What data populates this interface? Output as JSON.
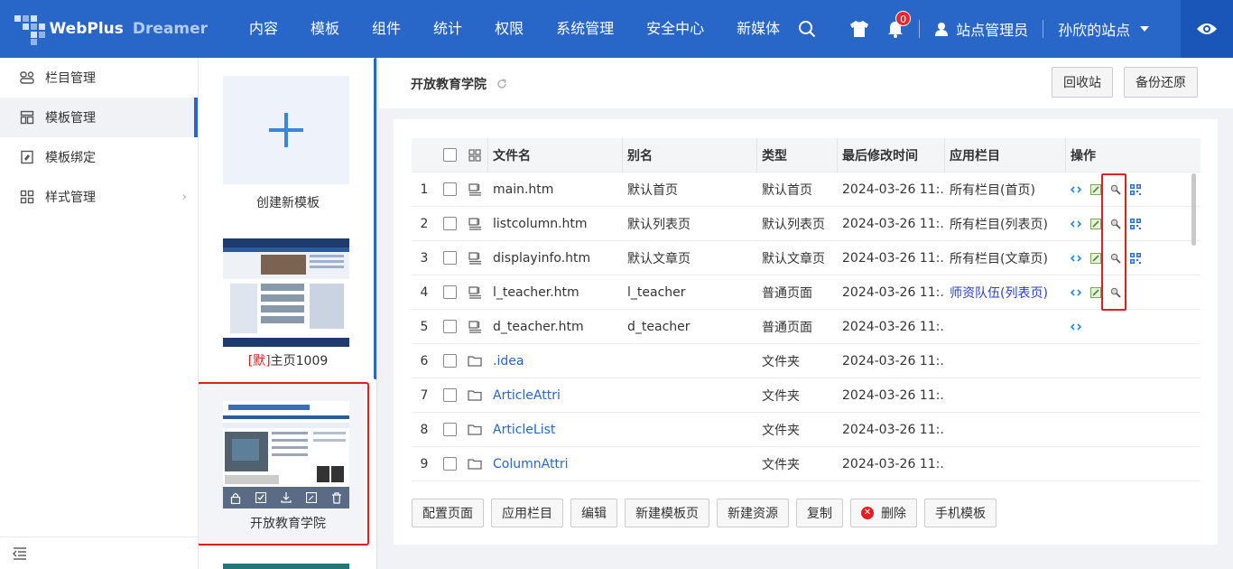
{
  "app": {
    "logo_text": "WebPlus",
    "logo_sub": "Dreamer"
  },
  "nav": [
    "内容",
    "模板",
    "组件",
    "统计",
    "权限",
    "系统管理",
    "安全中心",
    "新媒体"
  ],
  "top_right": {
    "notif_count": "0",
    "user_name": "站点管理员",
    "site_name": "孙欣的站点"
  },
  "sidebar": {
    "items": [
      {
        "label": "栏目管理",
        "icon": "column-icon"
      },
      {
        "label": "模板管理",
        "icon": "template-icon"
      },
      {
        "label": "模板绑定",
        "icon": "bind-icon"
      },
      {
        "label": "样式管理",
        "icon": "style-icon"
      }
    ]
  },
  "templates": {
    "create_label": "创建新模板",
    "item1_prefix": "[默]",
    "item1_name": "主页1009",
    "item2_name": "开放教育学院"
  },
  "header": {
    "title": "开放教育学院",
    "recycle_btn": "回收站",
    "backup_btn": "备份还原"
  },
  "table": {
    "headers": {
      "name": "文件名",
      "alias": "别名",
      "kind": "类型",
      "time": "最后修改时间",
      "column": "应用栏目",
      "ops": "操作"
    },
    "rows": [
      {
        "idx": "1",
        "type": "file",
        "name": "main.htm",
        "alias": "默认首页",
        "kind": "默认首页",
        "time": "2024-03-26 11:...",
        "column": "所有栏目(首页)",
        "ops": 4
      },
      {
        "idx": "2",
        "type": "file",
        "name": "listcolumn.htm",
        "alias": "默认列表页",
        "kind": "默认列表页",
        "time": "2024-03-26 11:...",
        "column": "所有栏目(列表页)",
        "ops": 4
      },
      {
        "idx": "3",
        "type": "file",
        "name": "displayinfo.htm",
        "alias": "默认文章页",
        "kind": "默认文章页",
        "time": "2024-03-26 11:...",
        "column": "所有栏目(文章页)",
        "ops": 4
      },
      {
        "idx": "4",
        "type": "file",
        "name": "l_teacher.htm",
        "alias": "l_teacher",
        "kind": "普通页面",
        "time": "2024-03-26 11:...",
        "column": "师资队伍(列表页)",
        "ops": 3
      },
      {
        "idx": "5",
        "type": "file",
        "name": "d_teacher.htm",
        "alias": "d_teacher",
        "kind": "普通页面",
        "time": "2024-03-26 11:...",
        "column": "",
        "ops": 1
      },
      {
        "idx": "6",
        "type": "folder",
        "name": ".idea",
        "alias": "",
        "kind": "文件夹",
        "time": "2024-03-26 11:...",
        "column": "",
        "ops": 0
      },
      {
        "idx": "7",
        "type": "folder",
        "name": "ArticleAttri",
        "alias": "",
        "kind": "文件夹",
        "time": "2024-03-26 11:...",
        "column": "",
        "ops": 0
      },
      {
        "idx": "8",
        "type": "folder",
        "name": "ArticleList",
        "alias": "",
        "kind": "文件夹",
        "time": "2024-03-26 11:...",
        "column": "",
        "ops": 0
      },
      {
        "idx": "9",
        "type": "folder",
        "name": "ColumnAttri",
        "alias": "",
        "kind": "文件夹",
        "time": "2024-03-26 11:...",
        "column": "",
        "ops": 0
      }
    ]
  },
  "buttons": [
    "配置页面",
    "应用栏目",
    "编辑",
    "新建模板页",
    "新建资源",
    "复制",
    "删除",
    "手机模板"
  ],
  "colors": {
    "primary": "#2866c7",
    "highlight": "#e02020",
    "link": "#2b3fd3"
  }
}
